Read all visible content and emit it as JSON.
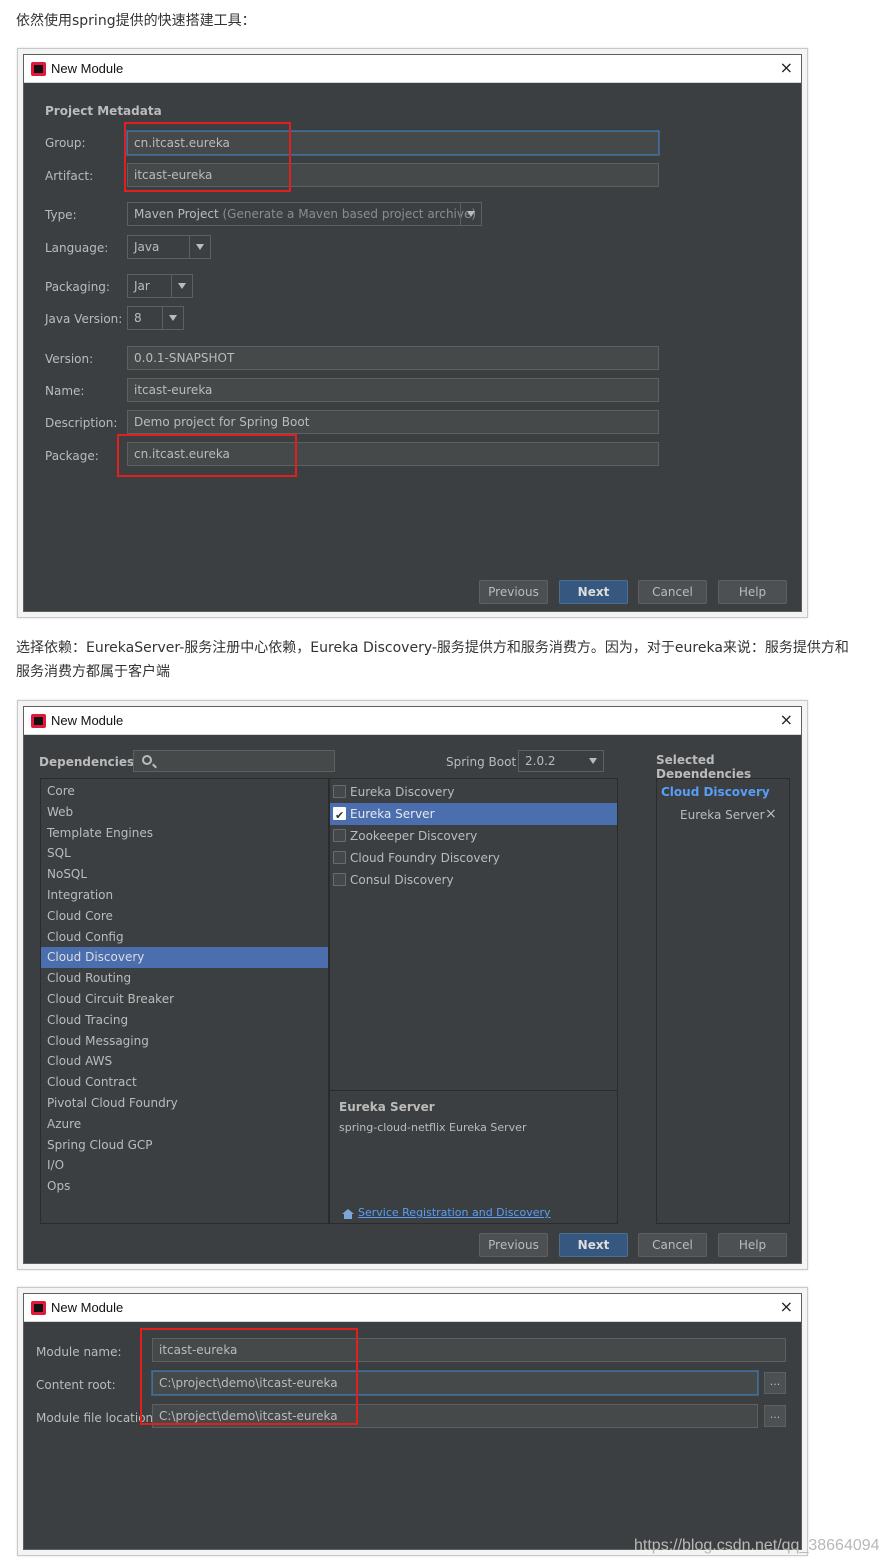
{
  "intro_text": "依然使用spring提供的快速搭建工具：",
  "deps_text": "选择依赖：EurekaServer-服务注册中心依赖，Eureka Discovery-服务提供方和服务消费方。因为，对于eureka来说：服务提供方和服务消费方都属于客户端",
  "window_title": "New Module",
  "close_icon": "×",
  "metadata": {
    "heading": "Project Metadata",
    "group_label": "Group:",
    "group_value": "cn.itcast.eureka",
    "artifact_label": "Artifact:",
    "artifact_value": "itcast-eureka",
    "type_label": "Type:",
    "type_value": "Maven Project",
    "type_hint": "(Generate a Maven based project archive)",
    "language_label": "Language:",
    "language_value": "Java",
    "packaging_label": "Packaging:",
    "packaging_value": "Jar",
    "java_version_label": "Java Version:",
    "java_version_value": "8",
    "version_label": "Version:",
    "version_value": "0.0.1-SNAPSHOT",
    "name_label": "Name:",
    "name_value": "itcast-eureka",
    "description_label": "Description:",
    "description_value": "Demo project for Spring Boot",
    "package_label": "Package:",
    "package_value": "cn.itcast.eureka"
  },
  "buttons": {
    "previous": "Previous",
    "next": "Next",
    "cancel": "Cancel",
    "help": "Help"
  },
  "dependencies": {
    "heading": "Dependencies",
    "spring_boot_label": "Spring Boot",
    "spring_boot_version": "2.0.2",
    "selected_heading": "Selected Dependencies",
    "categories": [
      "Core",
      "Web",
      "Template Engines",
      "SQL",
      "NoSQL",
      "Integration",
      "Cloud Core",
      "Cloud Config",
      "Cloud Discovery",
      "Cloud Routing",
      "Cloud Circuit Breaker",
      "Cloud Tracing",
      "Cloud Messaging",
      "Cloud AWS",
      "Cloud Contract",
      "Pivotal Cloud Foundry",
      "Azure",
      "Spring Cloud GCP",
      "I/O",
      "Ops"
    ],
    "selected_category_index": 8,
    "items": [
      {
        "label": "Eureka Discovery",
        "checked": false
      },
      {
        "label": "Eureka Server",
        "checked": true
      },
      {
        "label": "Zookeeper Discovery",
        "checked": false
      },
      {
        "label": "Cloud Foundry Discovery",
        "checked": false
      },
      {
        "label": "Consul Discovery",
        "checked": false
      }
    ],
    "detail_title": "Eureka Server",
    "detail_desc": "spring-cloud-netflix Eureka Server",
    "detail_link": "Service Registration and Discovery",
    "selected_group": "Cloud Discovery",
    "selected_item": "Eureka Server",
    "remove_icon": "×"
  },
  "module": {
    "name_label": "Module name:",
    "name_value": "itcast-eureka",
    "root_label": "Content root:",
    "root_value": "C:\\project\\demo\\itcast-eureka",
    "file_label": "Module file location:",
    "file_value": "C:\\project\\demo\\itcast-eureka",
    "browse": "..."
  },
  "watermark": "https://blog.csdn.net/qq_38664094"
}
